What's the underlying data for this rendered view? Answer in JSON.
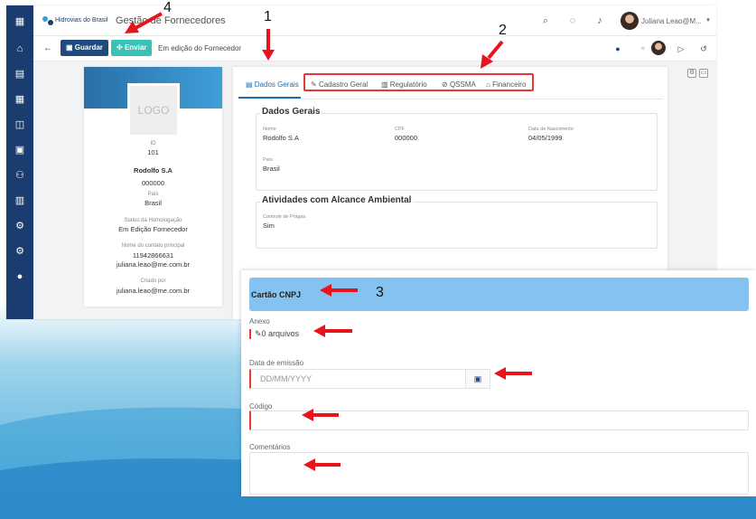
{
  "topbar": {
    "brand": "Hidrovias do Brasil",
    "app_title": "Gestão de Fornecedores",
    "user_name": "Juliana Leao@M...",
    "icons": [
      "search-icon",
      "chat-icon",
      "bell-icon"
    ]
  },
  "actionbar": {
    "back": "←",
    "save_label": "Guardar",
    "send_label": "Enviar",
    "status": "Em edição do Fornecedor"
  },
  "profile": {
    "logo": "LOGO",
    "id_label": "ID",
    "id_value": "101",
    "name": "Rodolfo S.A",
    "code": "000000",
    "country_label": "País",
    "country": "Brasil",
    "status_label": "Status da Homologação",
    "status": "Em Edição Fornecedor",
    "contact_label": "Nome do contato principal",
    "contact_phone": "11942866631",
    "contact_email": "juliana.leao@me.com.br",
    "created_label": "Criado por",
    "created_by": "juliana.leao@me.com.br"
  },
  "tabs": [
    {
      "label": "Dados Gerais",
      "icon": "document-icon"
    },
    {
      "label": "Cadastro Geral",
      "icon": "edit-icon"
    },
    {
      "label": "Regulatório",
      "icon": "table-icon"
    },
    {
      "label": "QSSMA",
      "icon": "link-icon"
    },
    {
      "label": "Financeiro",
      "icon": "bank-icon"
    }
  ],
  "dados_gerais": {
    "title": "Dados Gerais",
    "nome_label": "Nome",
    "nome": "Rodolfo S.A",
    "cpf_label": "CPF",
    "cpf": "000000",
    "nasc_label": "Data de Nascimento",
    "nasc": "04/05/1999",
    "pais_label": "País",
    "pais": "Brasil"
  },
  "atividades": {
    "title": "Atividades com Alcance Ambiental",
    "controle_label": "Controle de Pragas",
    "controle": "Sim"
  },
  "overlay": {
    "title": "Cartão CNPJ",
    "anexo_label": "Anexo",
    "anexo_value": "0 arquivos",
    "data_label": "Data de emissão",
    "data_placeholder": "DD/MM/YYYY",
    "codigo_label": "Código",
    "comentarios_label": "Comentários"
  },
  "annotations": [
    "1",
    "2",
    "3",
    "4"
  ],
  "colors": {
    "sidebar": "#1a3c6e",
    "primary": "#1f4a7e",
    "send": "#36c3b5",
    "highlight": "#e53935",
    "header_band": "#84c2f0"
  }
}
